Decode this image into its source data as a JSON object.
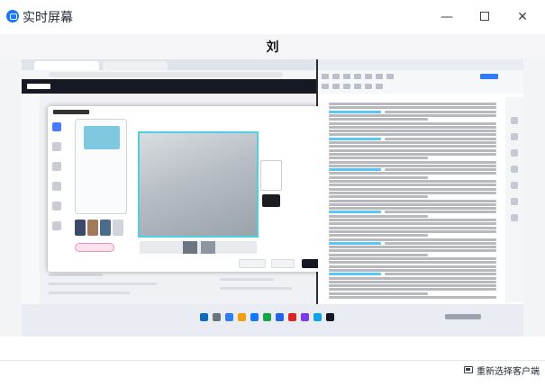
{
  "window": {
    "title": "实时屏幕",
    "controls": {
      "minimize": "—",
      "maximize": "",
      "close": "✕"
    }
  },
  "viewer": {
    "user_name": "刘"
  },
  "footer": {
    "reselect_label": "重新选择客户端"
  },
  "icons": {
    "app_logo": "monitor-logo-icon",
    "reselect": "monitor-icon"
  },
  "colors": {
    "accent": "#1677ff",
    "preview_frame": "#4dd0e1",
    "doc_highlight": "#4fc3f7",
    "taskbar": "#e9ecf3"
  }
}
